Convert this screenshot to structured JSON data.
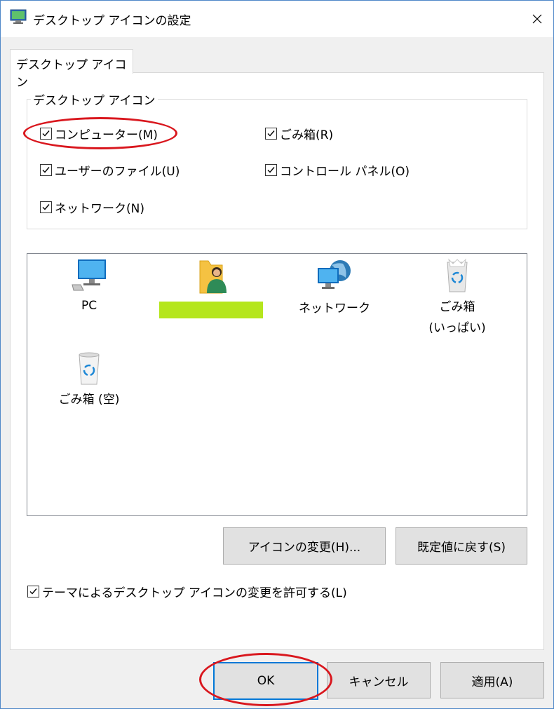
{
  "window": {
    "title": "デスクトップ アイコンの設定",
    "close_glyph": "✕"
  },
  "tabs": [
    {
      "label": "デスクトップ アイコン",
      "selected": true
    }
  ],
  "group": {
    "legend": "デスクトップ アイコン",
    "checkboxes": [
      {
        "label": "コンピューター(M)",
        "checked": true
      },
      {
        "label": "ごみ箱(R)",
        "checked": true
      },
      {
        "label": "ユーザーのファイル(U)",
        "checked": true
      },
      {
        "label": "コントロール パネル(O)",
        "checked": true
      },
      {
        "label": "ネットワーク(N)",
        "checked": true
      }
    ]
  },
  "preview_icons": [
    {
      "icon": "pc-monitor-icon",
      "label": "PC"
    },
    {
      "icon": "user-folder-icon",
      "label": ""
    },
    {
      "icon": "network-globe-icon",
      "label": "ネットワーク"
    },
    {
      "icon": "recycle-bin-full-icon",
      "label": "ごみ箱\n(いっぱい)"
    },
    {
      "icon": "recycle-bin-empty-icon",
      "label": "ごみ箱 (空)"
    }
  ],
  "buttons": {
    "change_icon": "アイコンの変更(H)...",
    "restore_default": "既定値に戻す(S)",
    "ok": "OK",
    "cancel": "キャンセル",
    "apply": "適用(A)"
  },
  "theme_checkbox": {
    "label": "テーマによるデスクトップ アイコンの変更を許可する(L)",
    "checked": true
  },
  "colors": {
    "annotation_red": "#d9171e",
    "selection_green": "#b5e61d",
    "default_button_border": "#0078d7"
  }
}
